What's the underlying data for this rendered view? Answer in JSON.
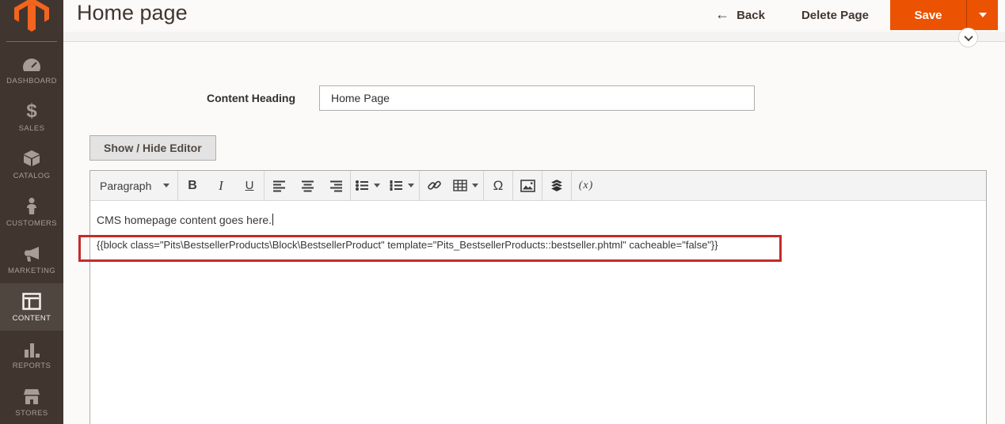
{
  "sidebar": {
    "items": [
      {
        "label": "DASHBOARD",
        "icon": "dashboard-icon"
      },
      {
        "label": "SALES",
        "icon": "sales-icon"
      },
      {
        "label": "CATALOG",
        "icon": "catalog-icon"
      },
      {
        "label": "CUSTOMERS",
        "icon": "customers-icon"
      },
      {
        "label": "MARKETING",
        "icon": "marketing-icon"
      },
      {
        "label": "CONTENT",
        "icon": "content-icon",
        "active": true
      },
      {
        "label": "REPORTS",
        "icon": "reports-icon"
      },
      {
        "label": "STORES",
        "icon": "stores-icon"
      }
    ]
  },
  "header": {
    "title": "Home page",
    "back_label": "Back",
    "delete_label": "Delete Page",
    "save_label": "Save"
  },
  "form": {
    "content_heading_label": "Content Heading",
    "content_heading_value": "Home Page",
    "show_hide_label": "Show / Hide Editor"
  },
  "editor": {
    "paragraph_label": "Paragraph",
    "bold_label": "B",
    "italic_label": "I",
    "underline_label": "U",
    "omega_label": "Ω",
    "variable_label": "(x)",
    "line1": "CMS homepage content goes here.",
    "line2": "{{block class=\"Pits\\BestsellerProducts\\Block\\BestsellerProduct\" template=\"Pits_BestsellerProducts::bestseller.phtml\" cacheable=\"false\"}}"
  },
  "colors": {
    "accent_orange": "#eb5202",
    "sidebar_bg": "#41362f",
    "annotation_red": "#c42c28",
    "border_gray": "#adadad"
  }
}
